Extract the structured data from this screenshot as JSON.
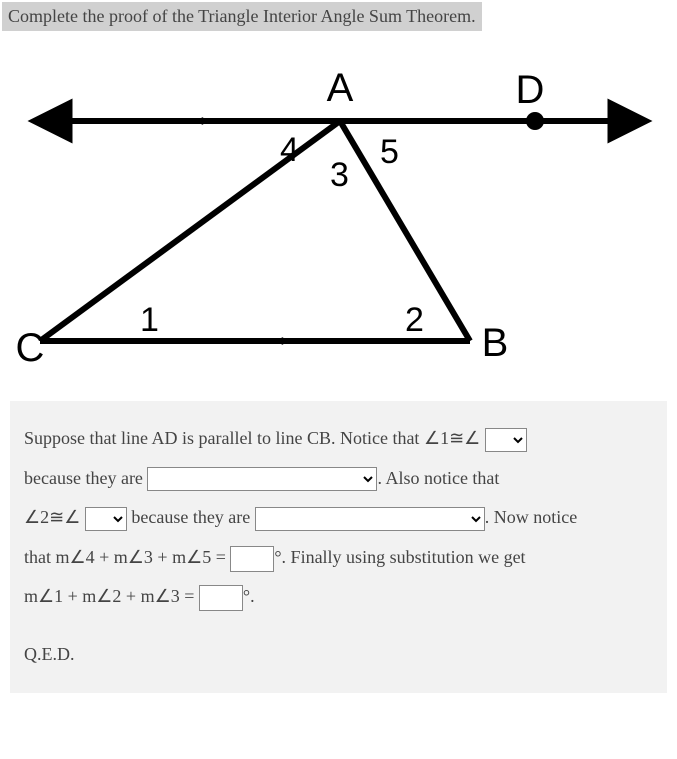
{
  "title": "Complete the proof of the Triangle Interior Angle Sum Theorem.",
  "diagram": {
    "points": {
      "A": "A",
      "B": "B",
      "C": "C",
      "D": "D"
    },
    "angles": {
      "1": "1",
      "2": "2",
      "3": "3",
      "4": "4",
      "5": "5"
    }
  },
  "proof": {
    "line1_pre": "Suppose that line AD is parallel to line CB. Notice that ∠1≅∠",
    "line2_pre": "because they are ",
    "line2_post": ". Also notice that",
    "line3_pre": "∠2≅∠",
    "line3_mid": " because they are ",
    "line3_post": ". Now notice",
    "line4_pre": "that m∠4 + m∠3 + m∠5 = ",
    "line4_post": "°. Finally using substitution we get",
    "line5_pre": "m∠1 + m∠2 + m∠3 = ",
    "line5_post": "°.",
    "qed": "Q.E.D."
  }
}
